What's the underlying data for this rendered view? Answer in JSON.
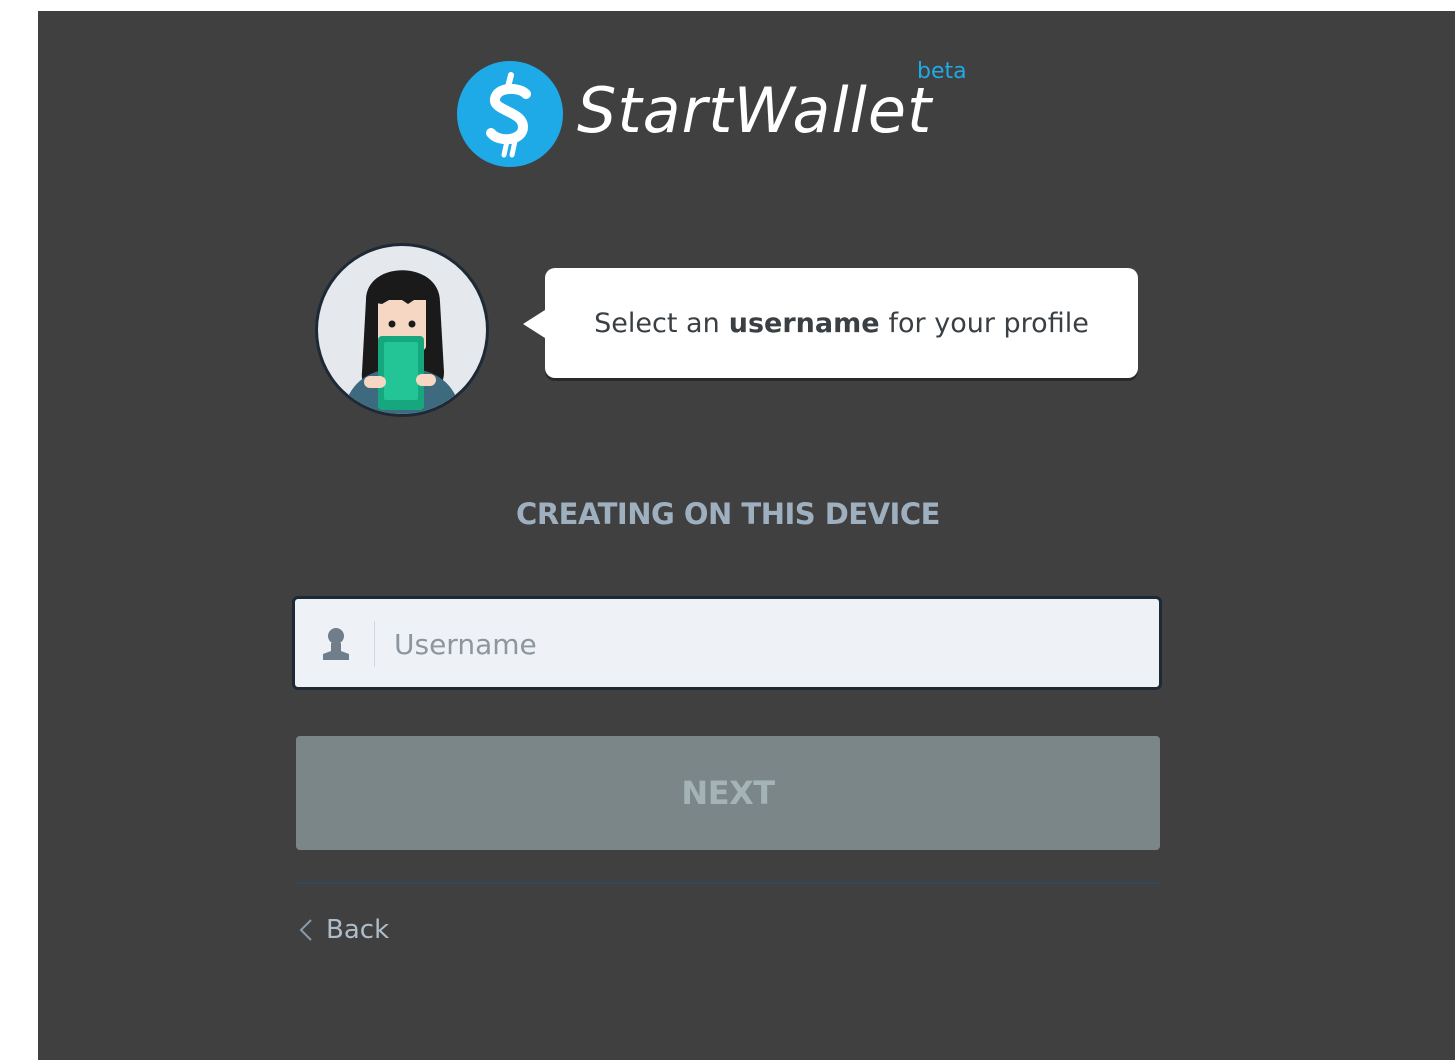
{
  "brand": {
    "name": "StartWallet",
    "badge": "beta",
    "accent_color": "#1eaae7"
  },
  "prompt": {
    "prefix": "Select an",
    "emphasis": "username",
    "suffix": "for your profile"
  },
  "section": {
    "heading": "CREATING ON THIS DEVICE"
  },
  "form": {
    "username": {
      "placeholder": "Username",
      "value": "",
      "icon": "user-icon"
    },
    "next_label": "NEXT"
  },
  "navigation": {
    "back_label": "Back",
    "back_icon": "chevron-left-icon"
  }
}
